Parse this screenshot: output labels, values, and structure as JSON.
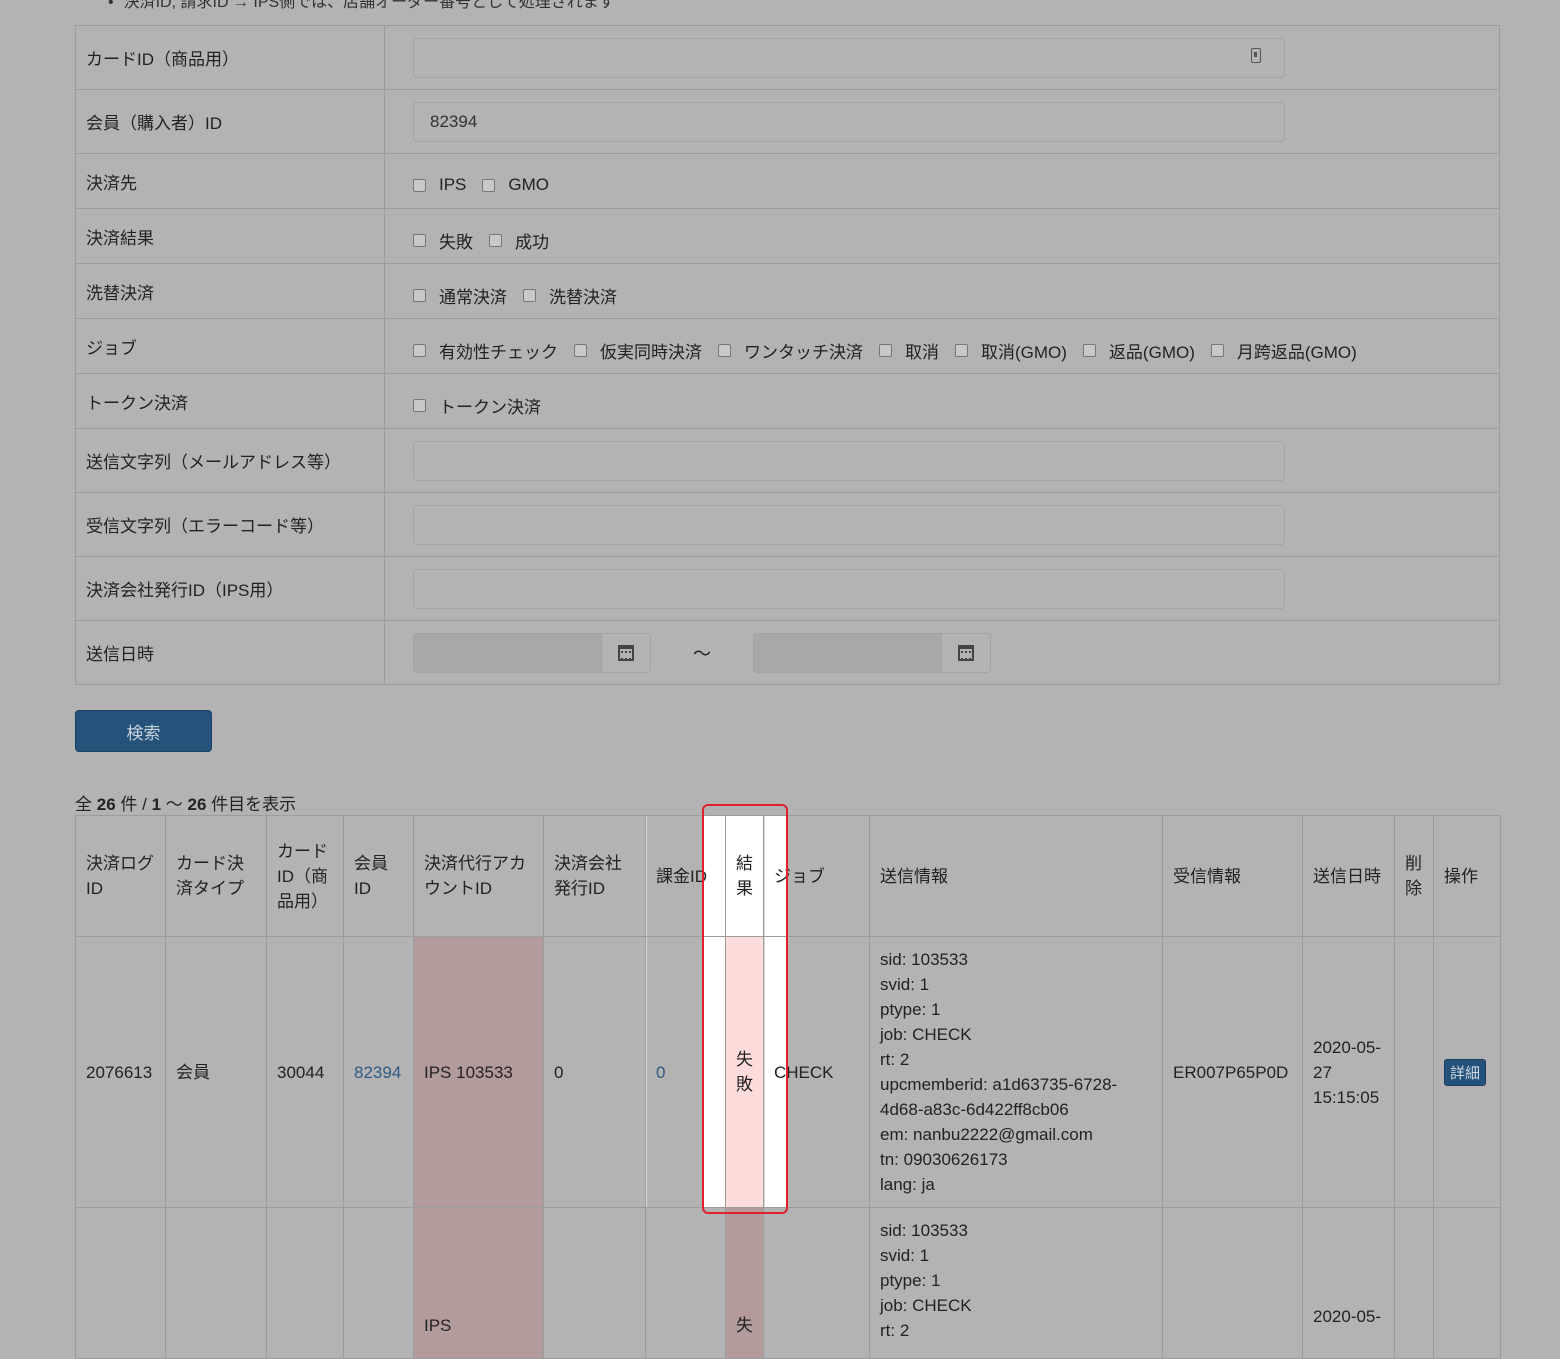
{
  "note": "決済ID, 請求ID → IPS側では、店舗オーダー番号として処理されます",
  "form": {
    "card_id_label": "カードID（商品用）",
    "member_id_label": "会員（購入者）ID",
    "member_id_value": "82394",
    "payee_label": "決済先",
    "payee_options": [
      "IPS",
      "GMO"
    ],
    "result_label": "決済結果",
    "result_options": [
      "失敗",
      "成功"
    ],
    "switch_label": "洗替決済",
    "switch_options": [
      "通常決済",
      "洗替決済"
    ],
    "job_label": "ジョブ",
    "job_options": [
      "有効性チェック",
      "仮実同時決済",
      "ワンタッチ決済",
      "取消",
      "取消(GMO)",
      "返品(GMO)",
      "月跨返品(GMO)"
    ],
    "token_label": "トークン決済",
    "token_options": [
      "トークン決済"
    ],
    "send_str_label": "送信文字列（メールアドレス等）",
    "recv_str_label": "受信文字列（エラーコード等）",
    "issuer_id_label": "決済会社発行ID（IPS用）",
    "send_date_label": "送信日時",
    "tilde": "～",
    "search_button": "検索"
  },
  "summary": {
    "prefix": "全",
    "total": "26",
    "unit1": "件 /",
    "start": "1",
    "range": "～",
    "end": "26",
    "suffix": "件目を表示"
  },
  "table": {
    "headers": [
      "決済ログID",
      "カード決済タイプ",
      "カードID（商品用）",
      "会員ID",
      "決済代行アカウントID",
      "決済会社発行ID",
      "課金ID",
      "結果",
      "ジョブ",
      "送信情報",
      "受信情報",
      "送信日時",
      "削除",
      "操作"
    ],
    "row1": {
      "log_id": "2076613",
      "card_type": "会員",
      "card_id": "30044",
      "member_id": "82394",
      "account_id": "IPS 103533",
      "issuer_id": "0",
      "charge_id": "0",
      "result": "失敗",
      "job": "CHECK",
      "send_info": [
        "sid: 103533",
        "svid: 1",
        "ptype: 1",
        "job: CHECK",
        "rt: 2",
        "upcmemberid: a1d63735-6728-4d68-a83c-6d422ff8cb06",
        "em: nanbu2222@gmail.com",
        "tn: 09030626173",
        "lang: ja"
      ],
      "recv_info": "ER007P65P0D",
      "send_date": "2020-05-27 15:15:05",
      "detail_button": "詳細"
    },
    "row2": {
      "account_id": "IPS",
      "result": "失",
      "send_info": [
        "sid: 103533",
        "svid: 1",
        "ptype: 1",
        "job: CHECK",
        "rt: 2"
      ],
      "send_date": "2020-05-"
    }
  }
}
